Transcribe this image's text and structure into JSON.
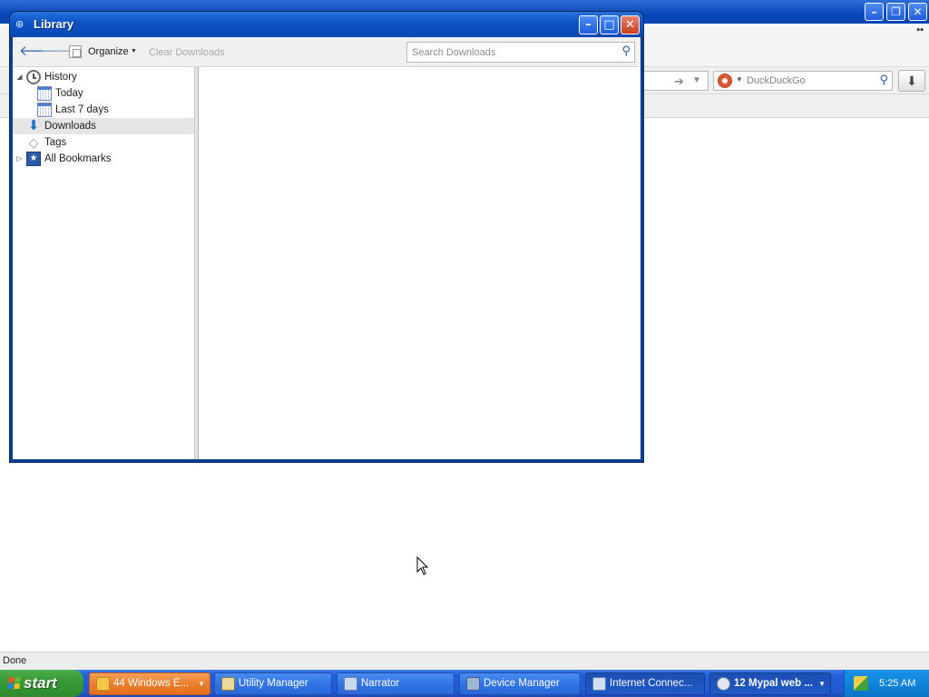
{
  "background_browser": {
    "search": {
      "engine_icon": "duckduckgo-icon",
      "placeholder": "DuckDuckGo"
    },
    "status_text": "Done",
    "window_buttons": [
      "–",
      "❐",
      "✕"
    ]
  },
  "library": {
    "title": "Library",
    "controls": {
      "minimize": "–",
      "maximize": "□",
      "close": "✕"
    },
    "toolbar": {
      "back_icon": "back-arrow-icon",
      "forward_icon": "forward-arrow-icon",
      "organize_label": "Organize",
      "clear_downloads_label": "Clear Downloads",
      "search_placeholder": "Search Downloads"
    },
    "tree": [
      {
        "label": "History",
        "icon": "clock-icon",
        "twisty": "◢"
      },
      {
        "label": "Today",
        "icon": "calendar-icon"
      },
      {
        "label": "Last 7 days",
        "icon": "calendar-icon"
      },
      {
        "label": "Downloads",
        "icon": "download-arrow-icon",
        "selected": true
      },
      {
        "label": "Tags",
        "icon": "tag-icon"
      },
      {
        "label": "All Bookmarks",
        "icon": "bookmarks-star-icon",
        "twisty": "▷"
      }
    ]
  },
  "taskbar": {
    "start_label": "start",
    "buttons": [
      {
        "label": "44 Windows E...",
        "icon": "folder-icon",
        "state": "flash"
      },
      {
        "label": "Utility Manager",
        "icon": "utility-manager-icon"
      },
      {
        "label": "Narrator",
        "icon": "narrator-icon"
      },
      {
        "label": "Device Manager",
        "icon": "device-manager-icon"
      },
      {
        "label": "Internet Connec...",
        "icon": "network-wizard-icon",
        "state": "active"
      },
      {
        "label": "12 Mypal web ...",
        "icon": "mypal-icon",
        "state": "active"
      }
    ],
    "tray": {
      "clock": "5:25 AM",
      "icon": "security-shield-icon"
    }
  },
  "colors": {
    "xp_blue": "#245edb",
    "start_green": "#3a9a38",
    "flash_orange": "#ea7e2e",
    "library_border": "#0b3e8f"
  }
}
